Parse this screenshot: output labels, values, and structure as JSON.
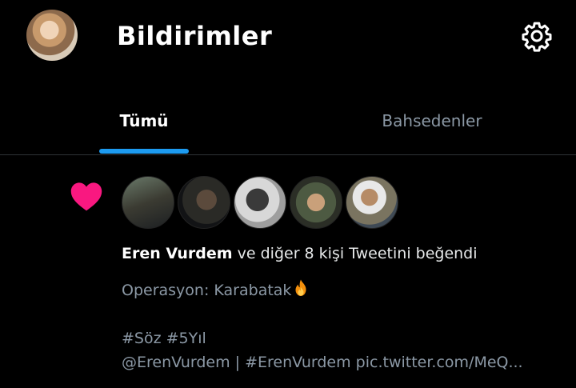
{
  "header": {
    "title": "Bildirimler",
    "profile_avatar": "user-profile-avatar",
    "settings_icon": "gear-icon"
  },
  "tabs": [
    {
      "label": "Tümü",
      "active": true
    },
    {
      "label": "Bahsedenler",
      "active": false
    }
  ],
  "colors": {
    "background": "#000000",
    "accent": "#1d9bf0",
    "like": "#f91880",
    "muted_text": "#8b98a5"
  },
  "notification": {
    "type_icon": "heart-icon",
    "liker_avatars": [
      "liker-avatar-1",
      "liker-avatar-2",
      "liker-avatar-3",
      "liker-avatar-4",
      "liker-avatar-5"
    ],
    "actor_name": "Eren Vurdem",
    "action_text": " ve diğer 8 kişi Tweetini beğendi",
    "tweet_lines": [
      "Operasyon: Karabatak",
      "",
      "#Söz #5Yıl",
      "@ErenVurdem | #ErenVurdem pic.twitter.com/MeQ..."
    ],
    "emoji_icon": "fire-icon"
  }
}
